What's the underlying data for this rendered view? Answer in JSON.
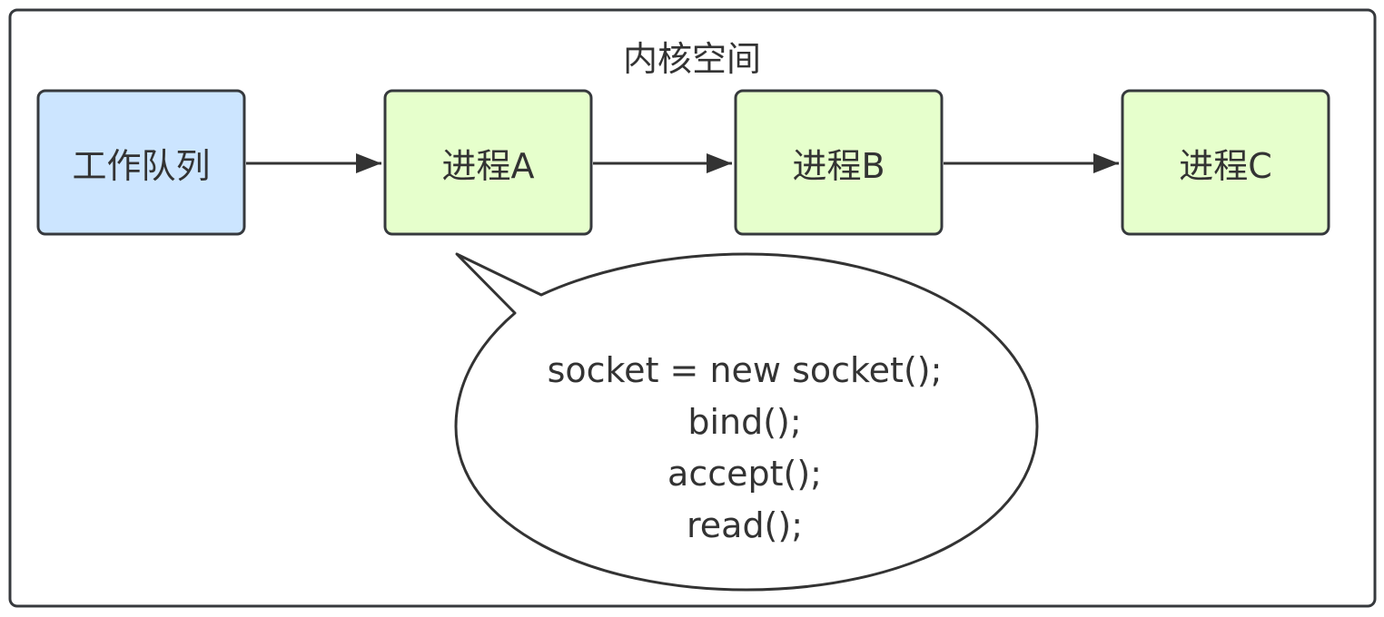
{
  "diagram": {
    "container_title": "内核空间",
    "nodes": {
      "queue": {
        "label": "工作队列",
        "fill": "#cce5ff",
        "stroke": "#36393d"
      },
      "proc_a": {
        "label": "进程A",
        "fill": "#e6ffcc",
        "stroke": "#36393d"
      },
      "proc_b": {
        "label": "进程B",
        "fill": "#e6ffcc",
        "stroke": "#36393d"
      },
      "proc_c": {
        "label": "进程C",
        "fill": "#e6ffcc",
        "stroke": "#36393d"
      }
    },
    "edges": [
      {
        "from": "queue",
        "to": "proc_a"
      },
      {
        "from": "proc_a",
        "to": "proc_b"
      },
      {
        "from": "proc_b",
        "to": "proc_c"
      }
    ],
    "callout": {
      "attached_to": "proc_a",
      "lines": [
        "socket = new socket();",
        "bind();",
        "accept();",
        "read();"
      ]
    },
    "colors": {
      "line": "#333333",
      "text": "#333333",
      "container_border": "#36393d"
    }
  }
}
